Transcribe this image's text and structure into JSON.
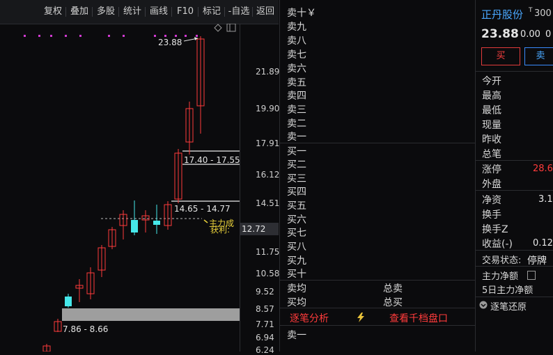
{
  "toolbar": {
    "buttons": [
      "复权",
      "叠加",
      "多股",
      "统计",
      "画线",
      "F10",
      "标记",
      "-自选",
      "返回"
    ]
  },
  "chart": {
    "y_ticks": [
      "21.89",
      "19.90",
      "17.91",
      "16.12",
      "14.51",
      "12.72",
      "11.75",
      "10.58",
      "9.52",
      "8.57",
      "7.71",
      "6.94",
      "6.24"
    ],
    "current_price": "12.72",
    "high_label": "23.88",
    "range_labels": [
      "17.40 - 17.55",
      "14.65 - 14.77",
      "7.86 - 8.66"
    ],
    "annotation_1": "主力成",
    "annotation_2": "获利:"
  },
  "orderbook": {
    "sell_levels": [
      "卖十￥",
      "卖九",
      "卖八",
      "卖七",
      "卖六",
      "卖五",
      "卖四",
      "卖三",
      "卖二",
      "卖一"
    ],
    "buy_levels": [
      "买一",
      "买二",
      "买三",
      "买四",
      "买五",
      "买六",
      "买七",
      "买八",
      "买九",
      "买十"
    ],
    "sell_avg": "卖均",
    "buy_avg": "买均",
    "total_sell": "总卖",
    "total_buy": "总买",
    "tick_analysis": "逐笔分析",
    "lightning_icon": "lightning-icon",
    "view_thousand": "查看千档盘口",
    "bottom_sell": "卖一"
  },
  "side": {
    "stock_name": "正丹股份",
    "stock_badge": "T",
    "stock_code": "300",
    "price": "23.88",
    "change": "0.00",
    "change_pct": "0",
    "buy_button": "买",
    "sell_button": "卖",
    "fields": [
      "今开",
      "最高",
      "最低",
      "现量",
      "昨收",
      "总笔",
      "涨停",
      "外盘",
      "净资",
      "换手",
      "换手Z",
      "收益(-)"
    ],
    "limit_up_value": "28.6",
    "net_assets_value": "3.1",
    "eps_value": "0.12",
    "trade_status_label": "交易状态:",
    "trade_status_value": "停牌",
    "main_net": "主力净额",
    "five_day_net": "5日主力净额",
    "tick_restore": "逐笔还原"
  },
  "colors": {
    "up": "#ff3b3b",
    "down": "#46e8ea",
    "ma": "#d03bd0"
  }
}
